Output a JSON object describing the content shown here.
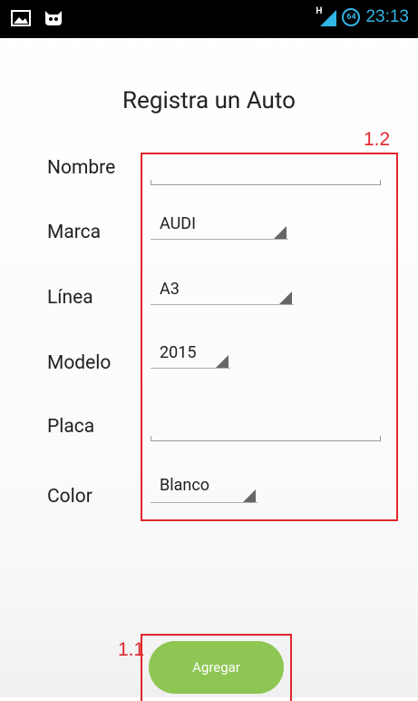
{
  "statusbar": {
    "time": "23:13",
    "network": "H",
    "battery": "64",
    "icons": [
      "image-icon",
      "cyanogen-bot-icon",
      "signal-icon",
      "battery-icon"
    ]
  },
  "form": {
    "title": "Registra un Auto",
    "fields": {
      "nombre": {
        "label": "Nombre",
        "value": ""
      },
      "marca": {
        "label": "Marca",
        "value": "AUDI"
      },
      "linea": {
        "label": "Línea",
        "value": "A3"
      },
      "modelo": {
        "label": "Modelo",
        "value": "2015"
      },
      "placa": {
        "label": "Placa",
        "value": ""
      },
      "color": {
        "label": "Color",
        "value": "Blanco"
      }
    },
    "submit_label": "Agregar"
  },
  "annotations": {
    "fields_box_label": "1.2",
    "button_box_label": "1.1",
    "color": "#e0262b"
  },
  "colors": {
    "accent": "#33b5e5",
    "button": "#8dc653"
  }
}
